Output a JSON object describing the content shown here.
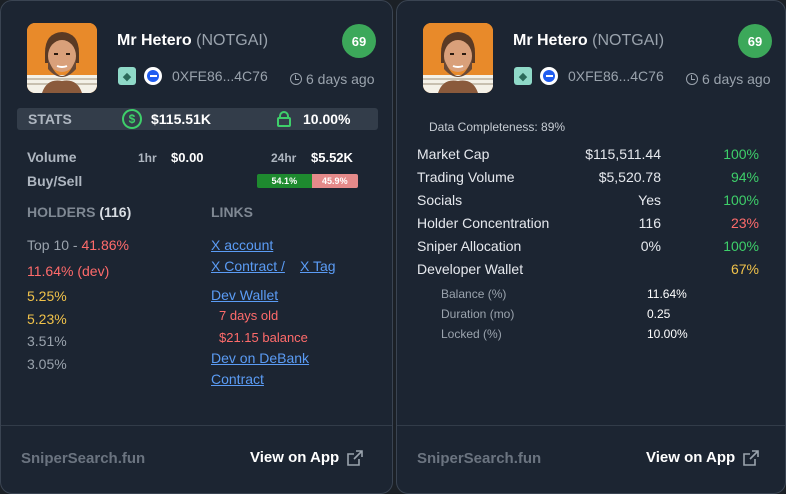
{
  "colors": {
    "green": "#3ecf6a",
    "red": "#ff6b6b",
    "yellow": "#f0c24a",
    "link": "#5b9cf5",
    "score_bg": "#3ca85a"
  },
  "token": {
    "name": "Mr Hetero",
    "ticker": "(NOTGAI)",
    "score": "69",
    "address": "0XFE86...4C76",
    "age": "6 days ago",
    "chain_icons": [
      "gem-icon",
      "base-chain-icon"
    ]
  },
  "left": {
    "stats": {
      "label": "STATS",
      "mcap": "$115.51K",
      "locked": "10.00%"
    },
    "volume": {
      "label": "Volume",
      "tf1": "1hr",
      "v1": "$0.00",
      "tf2": "24hr",
      "v2": "$5.52K"
    },
    "buysell": {
      "label": "Buy/Sell",
      "buy_pct": "54.1%",
      "sell_pct": "45.9%",
      "buy_fraction": 0.541
    },
    "holders": {
      "title": "HOLDERS",
      "count": "(116)",
      "top10_label": "Top 10 - ",
      "top10_value": "41.86%",
      "rows": [
        {
          "text": "11.64% (dev)",
          "color": "red"
        },
        {
          "text": "5.25%",
          "color": "yellow"
        },
        {
          "text": "5.23%",
          "color": "yellow"
        },
        {
          "text": "3.51%",
          "color": "gray"
        },
        {
          "text": "3.05%",
          "color": "gray"
        }
      ]
    },
    "links": {
      "title": "LINKS",
      "x_account": "X account ",
      "x_contract": "X Contract / ",
      "x_tag": " X Tag",
      "dev_wallet": "Dev Wallet",
      "dev_age": "7 days old",
      "dev_balance": "$21.15 balance",
      "debank": "Dev on DeBank",
      "contract": "Contract"
    }
  },
  "right": {
    "data_completeness": "Data Completeness: 89%",
    "metrics": [
      {
        "label": "Market Cap",
        "value": "$115,511.44",
        "pct": "100%",
        "color": "green"
      },
      {
        "label": "Trading Volume",
        "value": "$5,520.78",
        "pct": "94%",
        "color": "green"
      },
      {
        "label": "Socials",
        "value": "Yes",
        "pct": "100%",
        "color": "green"
      },
      {
        "label": "Holder Concentration",
        "value": "116",
        "pct": "23%",
        "color": "red"
      },
      {
        "label": "Sniper Allocation",
        "value": "0%",
        "pct": "100%",
        "color": "green"
      },
      {
        "label": "Developer Wallet",
        "value": "",
        "pct": "67%",
        "color": "yellow"
      }
    ],
    "dev_details": [
      {
        "label": "Balance (%)",
        "value": "11.64%"
      },
      {
        "label": "Duration (mo)",
        "value": "0.25"
      },
      {
        "label": "Locked (%)",
        "value": "10.00%"
      }
    ]
  },
  "footer": {
    "brand": "SniperSearch.fun",
    "view_app": "View on App"
  }
}
